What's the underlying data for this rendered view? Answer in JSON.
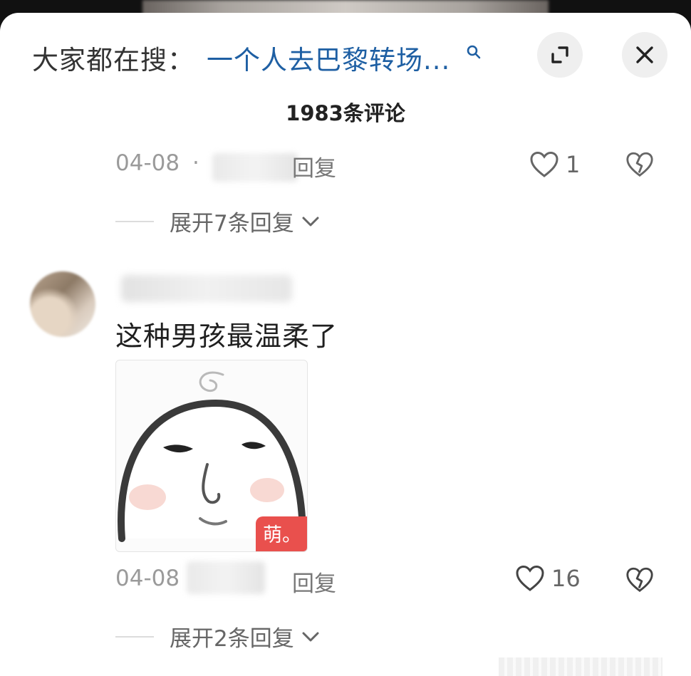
{
  "header": {
    "search_prefix": "大家都在搜：",
    "search_query": "一个人去巴黎转场...",
    "search_icon": "search-icon",
    "expand_icon": "expand-icon",
    "close_icon": "close-icon"
  },
  "title": "1983条评论",
  "comments": [
    {
      "date": "04-08",
      "separator": "·",
      "reply_label": "回复",
      "like_count": "1",
      "expand_label": "展开7条回复"
    },
    {
      "text": "这种男孩最温柔了",
      "sticker_badge": "萌。",
      "date": "04-08",
      "reply_label": "回复",
      "like_count": "16",
      "expand_label": "展开2条回复"
    }
  ],
  "colors": {
    "search_query": "#1e5fa3",
    "badge": "#e9504d"
  }
}
